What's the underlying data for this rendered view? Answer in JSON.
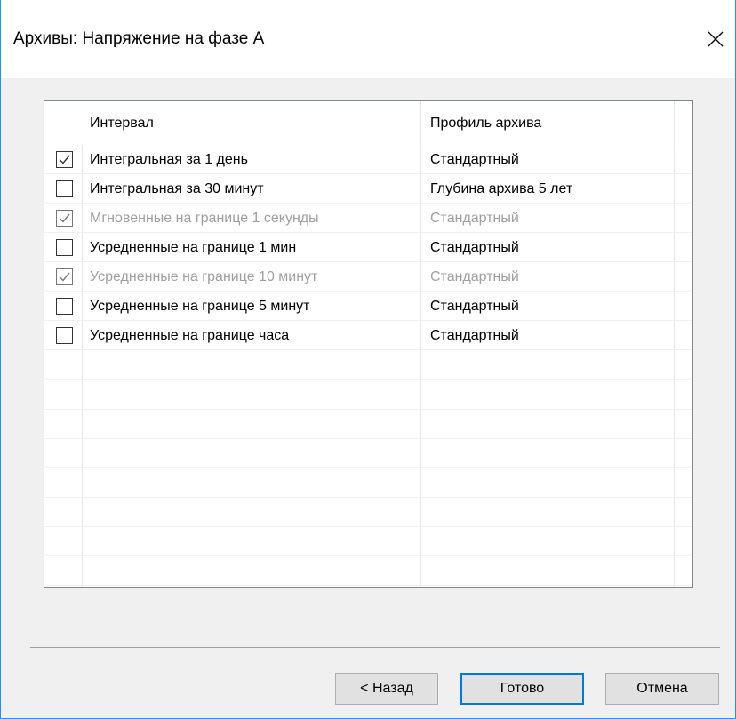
{
  "window": {
    "title": "Архивы: Напряжение на фазе А",
    "close_icon": "close-icon"
  },
  "list": {
    "columns": [
      "Интервал",
      "Профиль архива"
    ],
    "rows": [
      {
        "interval": "Интегральная за 1 день",
        "profile": "Стандартный",
        "checked": true,
        "enabled": true
      },
      {
        "interval": "Интегральная за 30 минут",
        "profile": "Глубина архива 5 лет",
        "checked": false,
        "enabled": true
      },
      {
        "interval": "Мгновенные на границе 1 секунды",
        "profile": "Стандартный",
        "checked": true,
        "enabled": false
      },
      {
        "interval": "Усредненные на границе 1 мин",
        "profile": "Стандартный",
        "checked": false,
        "enabled": true
      },
      {
        "interval": "Усредненные на границе 10 минут",
        "profile": "Стандартный",
        "checked": true,
        "enabled": false
      },
      {
        "interval": "Усредненные на границе 5 минут",
        "profile": "Стандартный",
        "checked": false,
        "enabled": true
      },
      {
        "interval": "Усредненные на границе часа",
        "profile": "Стандартный",
        "checked": false,
        "enabled": true
      }
    ]
  },
  "buttons": {
    "back": "< Назад",
    "finish": "Готово",
    "cancel": "Отмена"
  },
  "colors": {
    "accent": "#0078d7",
    "disabled_text": "#a0a0a0"
  }
}
